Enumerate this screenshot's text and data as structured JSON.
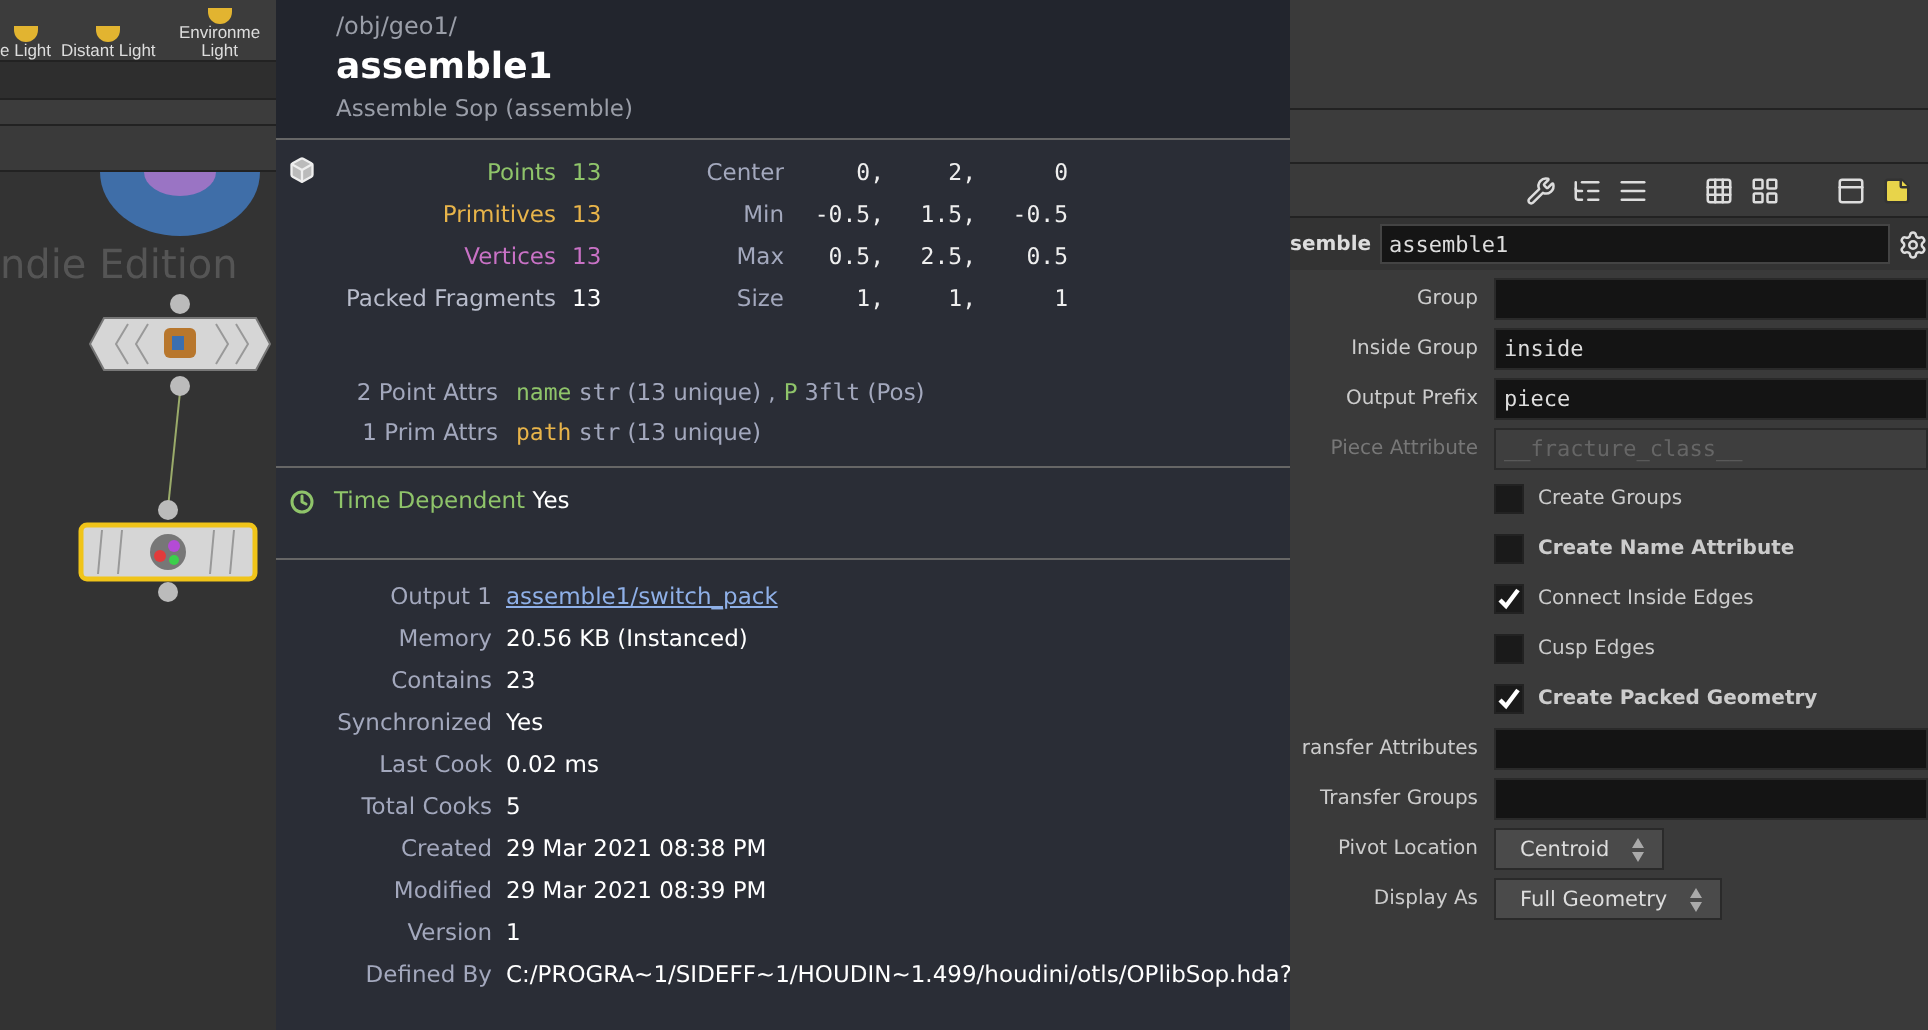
{
  "shelf": {
    "tools": [
      {
        "label": "e Light"
      },
      {
        "label": "Distant Light"
      },
      {
        "label": "Environme Light"
      }
    ]
  },
  "network": {
    "watermark": "ndie Edition",
    "nodes": [
      {
        "kind": "circle",
        "selected": false
      },
      {
        "kind": "hexagon",
        "selected": false
      },
      {
        "kind": "box",
        "selected": true
      }
    ]
  },
  "info_popup": {
    "path": "/obj/geo1/",
    "name": "assemble1",
    "type": "Assemble Sop (assemble)",
    "stats": [
      {
        "label": "Points",
        "value": "13",
        "color": "#8fc46a"
      },
      {
        "label": "Primitives",
        "value": "13",
        "color": "#e8b44a"
      },
      {
        "label": "Vertices",
        "value": "13",
        "color": "#c972c6"
      },
      {
        "label": "Packed Fragments",
        "value": "13",
        "color": "#b8bccb"
      }
    ],
    "bounds": [
      {
        "label": "Center",
        "values": [
          "0,",
          "2,",
          "0"
        ]
      },
      {
        "label": "Min",
        "values": [
          "-0.5,",
          "1.5,",
          "-0.5"
        ]
      },
      {
        "label": "Max",
        "values": [
          "0.5,",
          "2.5,",
          "0.5"
        ]
      },
      {
        "label": "Size",
        "values": [
          "1,",
          "1,",
          "1"
        ]
      }
    ],
    "attrs": [
      {
        "label": "2 Point Attrs",
        "separator": ",",
        "items": [
          {
            "name": "name",
            "type": "str",
            "detail": "(13 unique)",
            "color": "#8fc46a"
          },
          {
            "name": "P",
            "type": "3flt",
            "detail": "(Pos)",
            "color": "#8fc46a"
          }
        ]
      },
      {
        "label": "1 Prim Attrs",
        "items": [
          {
            "name": "path",
            "type": "str",
            "detail": "(13 unique)",
            "color": "#e8b44a"
          }
        ]
      }
    ],
    "time_dependent": {
      "label": "Time Dependent",
      "value": "Yes"
    },
    "details": [
      {
        "label": "Output 1",
        "value": "assemble1/switch_pack",
        "kind": "link"
      },
      {
        "label": "Memory",
        "value": "20.56 KB (Instanced)",
        "kind": "text"
      },
      {
        "label": "Contains",
        "value": "23",
        "kind": "text"
      },
      {
        "label": "Synchronized",
        "value": "Yes",
        "kind": "text"
      },
      {
        "label": "Last Cook",
        "value": "0.02 ms",
        "kind": "text"
      },
      {
        "label": "Total Cooks",
        "value": "5",
        "kind": "text"
      },
      {
        "label": "Created",
        "value": "29 Mar 2021 08:38 PM",
        "kind": "text"
      },
      {
        "label": "Modified",
        "value": "29 Mar 2021 08:39 PM",
        "kind": "text"
      },
      {
        "label": "Version",
        "value": "1",
        "kind": "text"
      },
      {
        "label": "Defined By",
        "value": "C:/PROGRA~1/SIDEFF~1/HOUDIN~1.499/houdini/otls/OPlibSop.hda?",
        "kind": "text"
      }
    ]
  },
  "parameters": {
    "type_label": "semble",
    "node_name": "assemble1",
    "rows": [
      {
        "kind": "field",
        "label": "Group",
        "value": ""
      },
      {
        "kind": "field",
        "label": "Inside Group",
        "value": "inside"
      },
      {
        "kind": "field",
        "label": "Output Prefix",
        "value": "piece"
      },
      {
        "kind": "field",
        "label": "Piece Attribute",
        "placeholder": "__fracture_class__",
        "disabled": true
      },
      {
        "kind": "checkbox",
        "label": "Create Groups",
        "checked": false,
        "emphasized": false
      },
      {
        "kind": "checkbox",
        "label": "Create Name Attribute",
        "checked": false,
        "emphasized": true
      },
      {
        "kind": "checkbox",
        "label": "Connect Inside Edges",
        "checked": true,
        "emphasized": false
      },
      {
        "kind": "checkbox",
        "label": "Cusp Edges",
        "checked": false,
        "emphasized": false
      },
      {
        "kind": "checkbox",
        "label": "Create Packed Geometry",
        "checked": true,
        "emphasized": true
      },
      {
        "kind": "field",
        "label": "ransfer Attributes",
        "value": ""
      },
      {
        "kind": "field",
        "label": "Transfer Groups",
        "value": ""
      },
      {
        "kind": "menu",
        "label": "Pivot Location",
        "value": "Centroid"
      },
      {
        "kind": "menu",
        "label": "Display As",
        "value": "Full Geometry"
      }
    ]
  }
}
